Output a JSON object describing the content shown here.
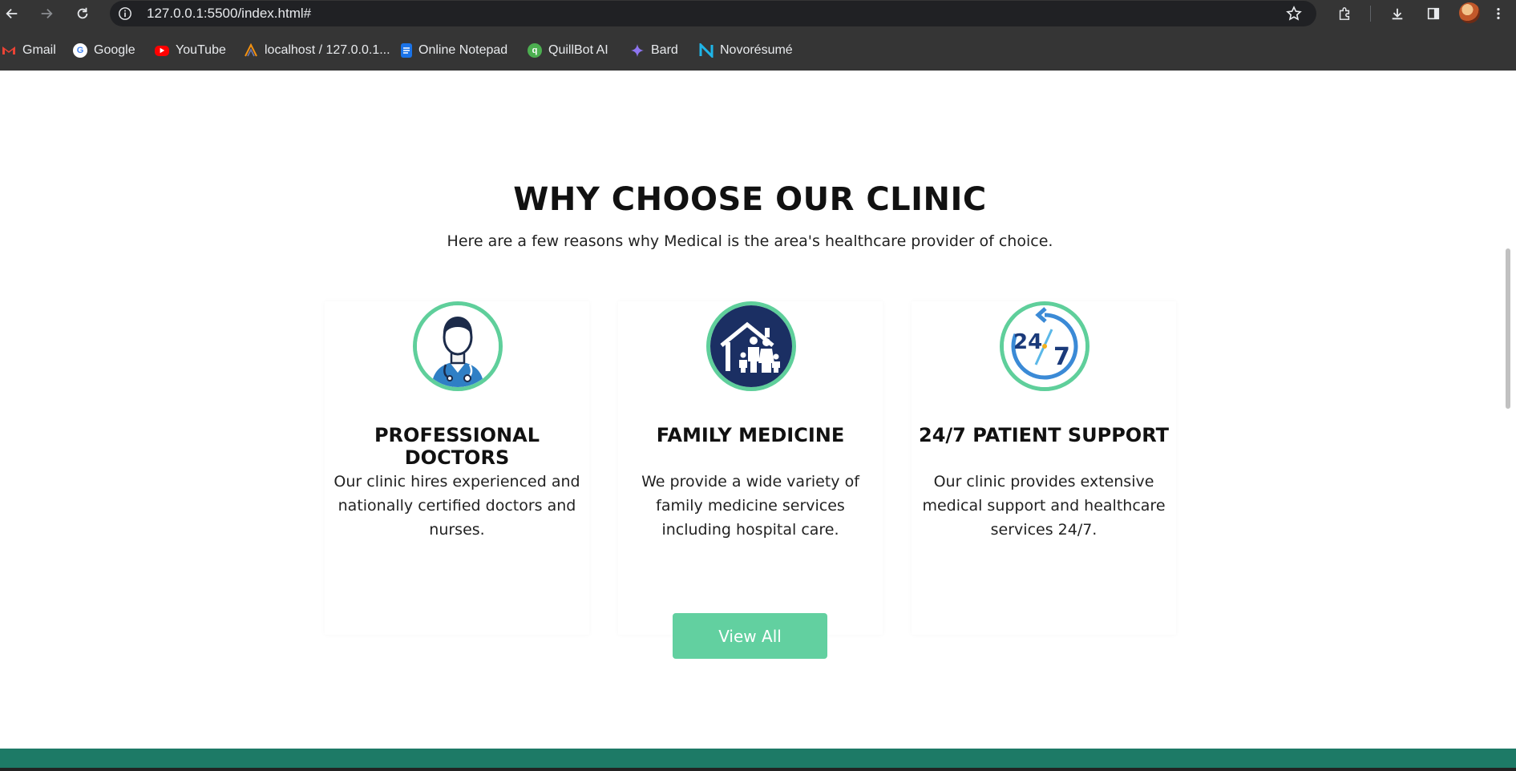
{
  "browser": {
    "url": "127.0.0.1:5500/index.html#",
    "bookmarks": [
      {
        "label": "Gmail",
        "icon": "gmail-icon",
        "color": "#ea4335"
      },
      {
        "label": "Google",
        "icon": "google-icon",
        "color": "#4285f4"
      },
      {
        "label": "YouTube",
        "icon": "youtube-icon",
        "color": "#ff0000"
      },
      {
        "label": "localhost / 127.0.0.1...",
        "icon": "phpmyadmin-icon",
        "color": "#f29111"
      },
      {
        "label": "Online Notepad",
        "icon": "notepad-icon",
        "color": "#1a73e8"
      },
      {
        "label": "QuillBot AI",
        "icon": "quillbot-icon",
        "color": "#4caf50"
      },
      {
        "label": "Bard",
        "icon": "bard-icon",
        "color": "#8e75f0"
      },
      {
        "label": "Novorésumé",
        "icon": "novoresume-icon",
        "color": "#1fb5e8"
      }
    ]
  },
  "section": {
    "title": "WHY CHOOSE OUR CLINIC",
    "subtitle": "Here are a few reasons why Medical is the area's healthcare provider of choice.",
    "cards": [
      {
        "title": "PROFESSIONAL DOCTORS",
        "text": "Our clinic hires experienced and nationally certified doctors and nurses.",
        "icon": "doctor-icon"
      },
      {
        "title": "FAMILY MEDICINE",
        "text": "We provide a wide variety of family medicine services including hospital care.",
        "icon": "family-icon"
      },
      {
        "title": "24/7 PATIENT SUPPORT",
        "text": "Our clinic provides extensive medical support and healthcare services 24/7.",
        "icon": "clock-24-7-icon"
      }
    ],
    "button_label": "View All"
  },
  "colors": {
    "accent": "#62d0a0",
    "ring": "#5fcf9b",
    "navy": "#1b2f63",
    "footer": "#1d7a66"
  }
}
